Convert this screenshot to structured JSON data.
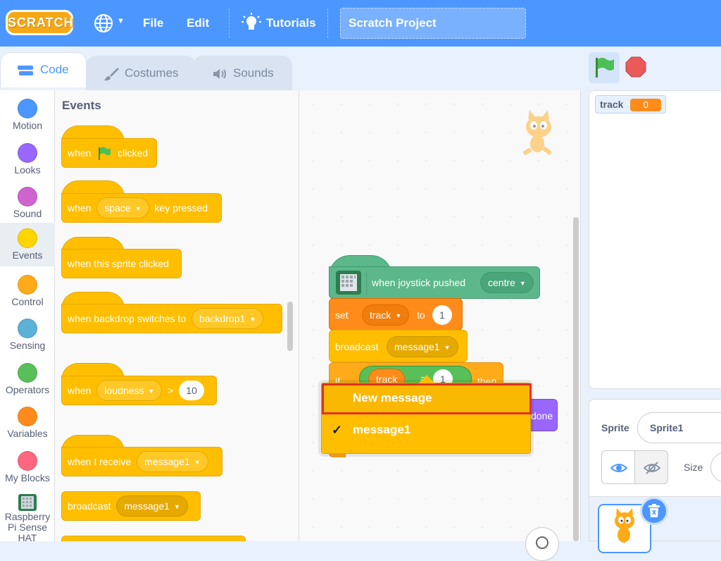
{
  "menubar": {
    "logo": "SCRATCH",
    "file": "File",
    "edit": "Edit",
    "tutorials": "Tutorials",
    "project_title": "Scratch Project"
  },
  "tabs": [
    {
      "label": "Code"
    },
    {
      "label": "Costumes"
    },
    {
      "label": "Sounds"
    }
  ],
  "categories": [
    {
      "label": "Motion",
      "color": "#4c97ff"
    },
    {
      "label": "Looks",
      "color": "#9966ff"
    },
    {
      "label": "Sound",
      "color": "#cf63cf"
    },
    {
      "label": "Events",
      "color": "#ffd500"
    },
    {
      "label": "Control",
      "color": "#ffab19"
    },
    {
      "label": "Sensing",
      "color": "#5cb1d6"
    },
    {
      "label": "Operators",
      "color": "#59c059"
    },
    {
      "label": "Variables",
      "color": "#ff8c1a"
    },
    {
      "label": "My Blocks",
      "color": "#ff6680"
    },
    {
      "label": "Raspberry Pi Sense HAT",
      "color": "#0fbd8c"
    }
  ],
  "palette": {
    "title": "Events",
    "b1": {
      "when": "when",
      "clicked": "clicked"
    },
    "b2": {
      "when": "when",
      "key": "space",
      "pressed": "key pressed"
    },
    "b3": {
      "text": "when this sprite clicked"
    },
    "b4": {
      "text": "when backdrop switches to",
      "backdrop": "backdrop1"
    },
    "b5": {
      "when": "when",
      "sensor": "loudness",
      "op": ">",
      "value": "10"
    },
    "b6": {
      "text": "when I receive",
      "message": "message1"
    },
    "b7": {
      "text": "broadcast",
      "message": "message1"
    }
  },
  "workspace": {
    "hat": {
      "text": "when joystick pushed",
      "dir": "centre"
    },
    "set": {
      "set": "set",
      "var": "track",
      "to": "to",
      "value": "1"
    },
    "broadcast": {
      "text": "broadcast",
      "message": "message1"
    },
    "if": {
      "if": "if",
      "var": "track",
      "eq": "=",
      "value": "1",
      "then": "then"
    },
    "done": "done"
  },
  "dropdown": {
    "new_message": "New message",
    "selected": "message1",
    "check": "✓"
  },
  "stage": {
    "monitor_label": "track",
    "monitor_value": "0"
  },
  "sprite_info": {
    "sprite_label": "Sprite",
    "sprite_name": "Sprite1",
    "size_label": "Size"
  }
}
